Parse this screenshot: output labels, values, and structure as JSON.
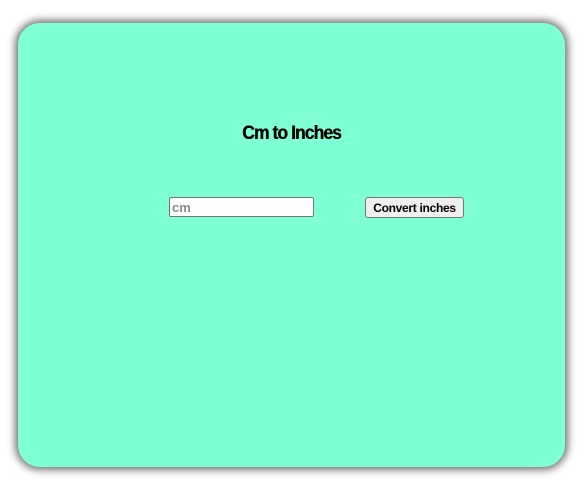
{
  "app": {
    "title": "Cm to Inches"
  },
  "form": {
    "cm_input": {
      "value": "",
      "placeholder": "cm"
    },
    "convert_button_label": "Convert inches"
  },
  "colors": {
    "card_background": "#7fffd4",
    "page_background": "#ffffff"
  }
}
